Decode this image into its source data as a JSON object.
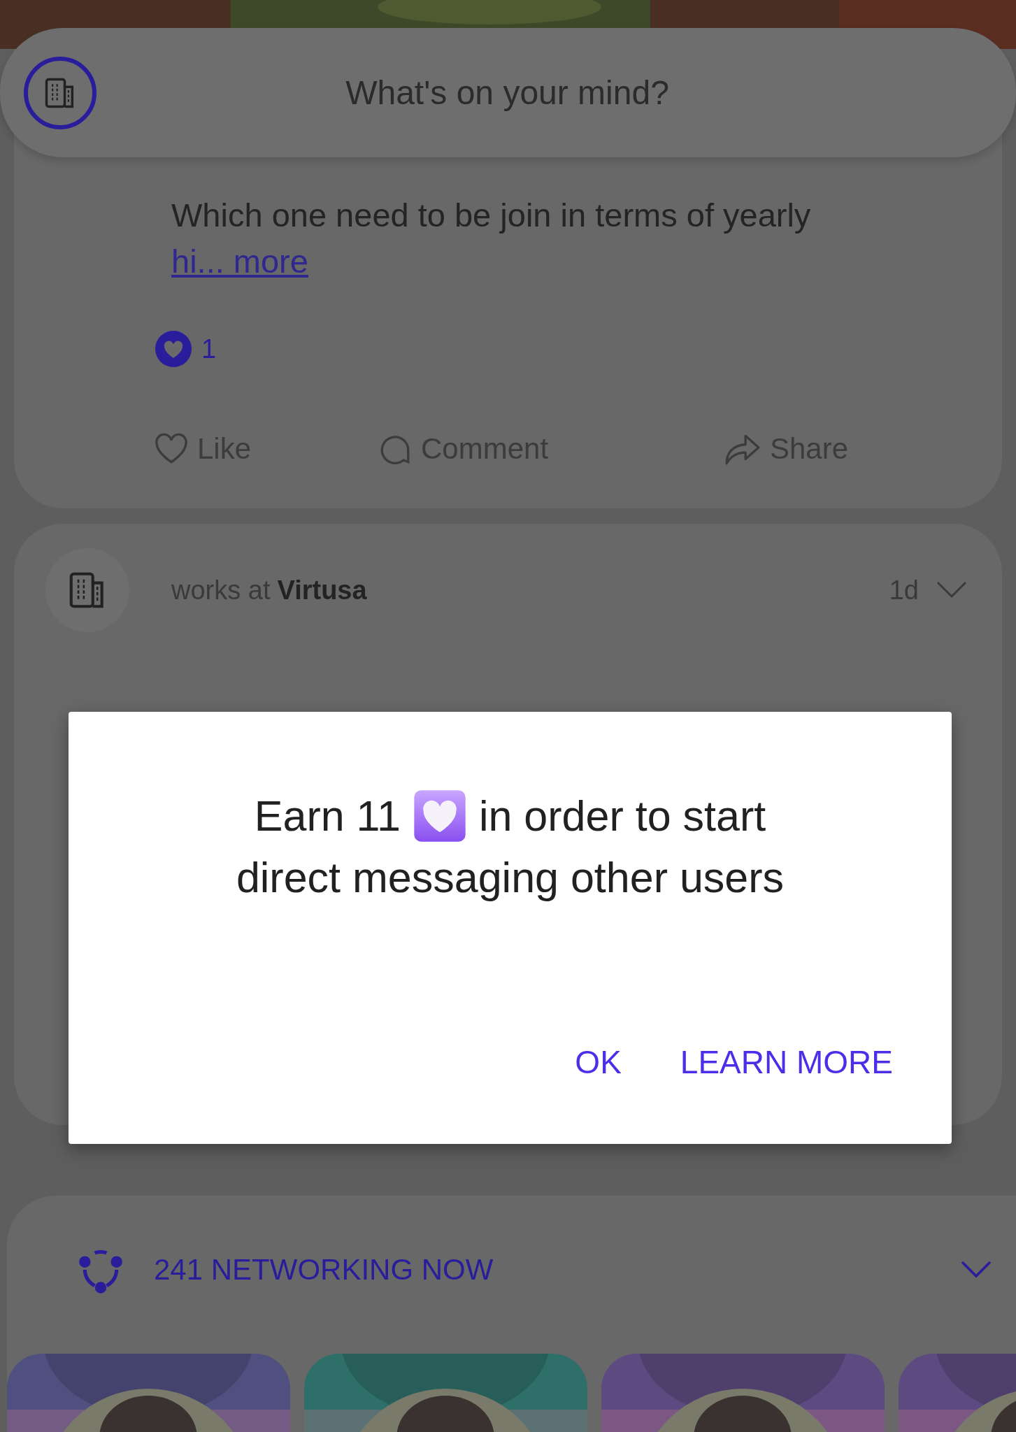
{
  "composer": {
    "placeholder": "What's on your mind?"
  },
  "post": {
    "body": "Which one need to be join in terms of yearly",
    "more_link": "hi... more",
    "reaction_count": "1",
    "actions": [
      {
        "kind": "like",
        "label": "Like"
      },
      {
        "kind": "comment",
        "label": "Comment"
      },
      {
        "kind": "share",
        "label": "Share"
      }
    ]
  },
  "next_post": {
    "prefix": "works at",
    "company": "Virtusa",
    "age": "1d"
  },
  "dialog": {
    "line1_start": "Earn 11",
    "line1_end": "in order to start",
    "line2": "direct messaging other users",
    "buttons": [
      "OK",
      "LEARN MORE"
    ]
  },
  "networking": {
    "title": "241 NETWORKING NOW"
  }
}
